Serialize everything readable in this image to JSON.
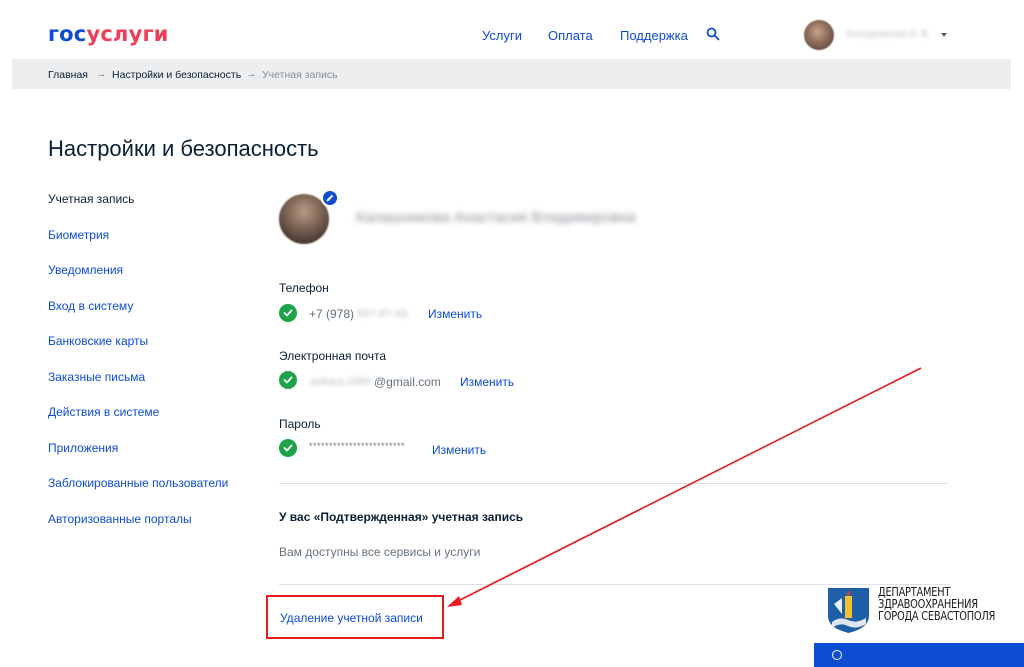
{
  "header": {
    "logo_part1": "гос",
    "logo_part2": "услуги",
    "nav": [
      "Услуги",
      "Оплата",
      "Поддержка"
    ],
    "user_name": "Колодникова А. В."
  },
  "breadcrumb": {
    "items": [
      "Главная",
      "Настройки и безопасность",
      "Учетная запись"
    ],
    "separator": "→"
  },
  "page_title": "Настройки и безопасность",
  "sidebar": {
    "items": [
      "Учетная запись",
      "Биометрия",
      "Уведомления",
      "Вход в систему",
      "Банковские карты",
      "Заказные письма",
      "Действия в системе",
      "Приложения",
      "Заблокированные пользователи",
      "Авторизованные порталы"
    ],
    "active_index": 0
  },
  "profile": {
    "full_name": "Калашникова Анастасия Владимировна",
    "phone": {
      "label": "Телефон",
      "prefix": "+7 (978)",
      "hidden": "557-87-43",
      "change": "Изменить"
    },
    "email": {
      "label": "Электронная почта",
      "hidden": "ankara.1990",
      "domain": "@gmail.com",
      "change": "Изменить"
    },
    "password": {
      "label": "Пароль",
      "value": "************************",
      "change": "Изменить"
    }
  },
  "account_status": {
    "title": "У вас «Подтвержденная» учетная запись",
    "text": "Вам доступны все сервисы и услуги"
  },
  "delete_account": "Удаление учетной записи",
  "department": {
    "lines": [
      "ДЕПАРТАМЕНТ",
      "ЗДРАВООХРАНЕНИЯ",
      "ГОРОДА  СЕВАСТОПОЛЯ"
    ]
  },
  "colors": {
    "brand_blue": "#0d4cd3",
    "brand_red": "#ee3f58",
    "success_green": "#1ea34a",
    "annotation_red": "#e51a1a"
  }
}
